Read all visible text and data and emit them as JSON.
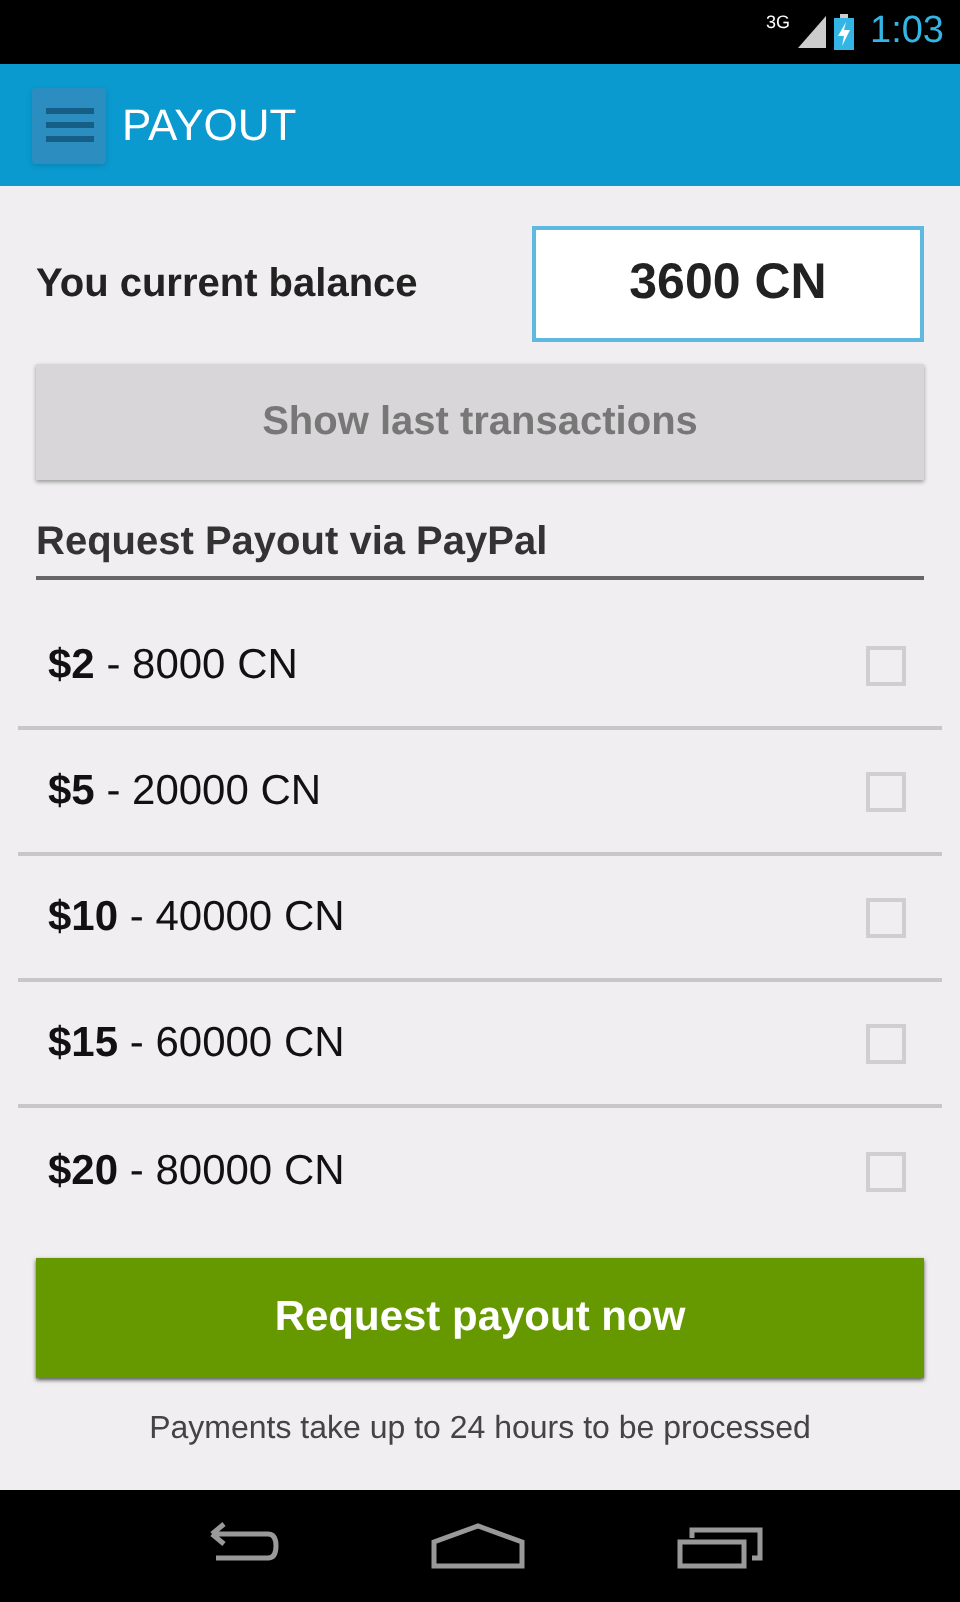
{
  "status_bar": {
    "network": "3G",
    "time": "1:03"
  },
  "app_bar": {
    "title": "PAYOUT"
  },
  "balance": {
    "label": "You current balance",
    "value": "3600 CN"
  },
  "history_button": {
    "label": "Show last transactions"
  },
  "section": {
    "title": "Request Payout via PayPal"
  },
  "options": [
    {
      "label": "**$2** - 8000 CN",
      "checked": false
    },
    {
      "label": "**$5** - 20000 CN",
      "checked": false
    },
    {
      "label": "**$10** - 40000 CN",
      "checked": false
    },
    {
      "label": "**$15** - 60000 CN",
      "checked": false
    },
    {
      "label": "**$20** - 80000 CN",
      "checked": false
    }
  ],
  "submit_button": {
    "label": "Request payout now"
  },
  "note": "Payments take up to 24 hours to be processed"
}
